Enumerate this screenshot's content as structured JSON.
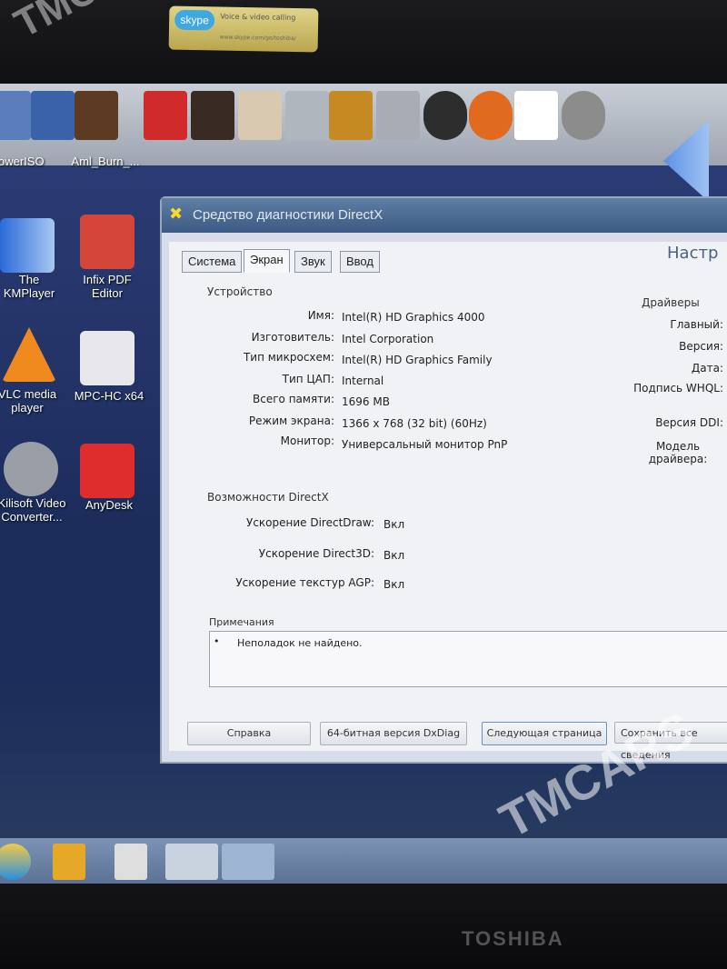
{
  "sticker": {
    "logo": "skype",
    "tagline": "Voice & video calling",
    "url": "www.skype.com/go/toshiba/"
  },
  "watermark": "TMCARS",
  "toolbar": {
    "labels": [
      "owerISO",
      "Aml_Burn_..."
    ],
    "icon_names": [
      "poweriso-icon",
      "burn-app-icon",
      "anydesk-icon",
      "game-icon",
      "game-icon",
      "cs-icon",
      "game-icon",
      "gta-iv-icon",
      "settings-icon",
      "aimp-icon",
      "mpc-hc-icon",
      "video-converter-icon",
      "kmplayer-icon"
    ]
  },
  "desktop_icons": [
    {
      "label": "The KMPlayer",
      "icon": "kmplayer-icon"
    },
    {
      "label": "Infix PDF Editor",
      "icon": "pdf-editor-icon"
    },
    {
      "label": "VLC media player",
      "icon": "vlc-icon"
    },
    {
      "label": "MPC-HC x64",
      "icon": "mpc-hc-icon"
    },
    {
      "label": "Kilisoft Video Converter...",
      "icon": "video-converter-icon"
    },
    {
      "label": "AnyDesk",
      "icon": "anydesk-icon"
    }
  ],
  "dialog": {
    "title": "Средство диагностики DirectX",
    "tabs": [
      "Система",
      "Экран",
      "Звук",
      "Ввод"
    ],
    "active_tab": "Экран",
    "right_heading": "Настр",
    "device_group": "Устройство",
    "device": [
      {
        "label": "Имя:",
        "value": "Intel(R) HD Graphics 4000"
      },
      {
        "label": "Изготовитель:",
        "value": "Intel Corporation"
      },
      {
        "label": "Тип микросхем:",
        "value": "Intel(R) HD Graphics Family"
      },
      {
        "label": "Тип ЦАП:",
        "value": "Internal"
      },
      {
        "label": "Всего памяти:",
        "value": "1696 MB"
      },
      {
        "label": "Режим экрана:",
        "value": "1366 x 768 (32 bit) (60Hz)"
      },
      {
        "label": "Монитор:",
        "value": "Универсальный монитор PnP"
      }
    ],
    "drivers_group": "Драйверы",
    "drivers": [
      "Главный:",
      "Версия:",
      "Дата:",
      "Подпись WHQL:",
      "Версия DDI:",
      "Модель драйвера:"
    ],
    "directx_group": "Возможности DirectX",
    "directx": [
      {
        "label": "Ускорение DirectDraw:",
        "value": "Вкл"
      },
      {
        "label": "Ускорение Direct3D:",
        "value": "Вкл"
      },
      {
        "label": "Ускорение текстур AGP:",
        "value": "Вкл"
      }
    ],
    "notes_group": "Примечания",
    "notes": "Неполадок не найдено.",
    "buttons": [
      "Справка",
      "64-битная версия DxDiag",
      "Следующая страница",
      "Сохранить все сведения"
    ]
  },
  "taskbar": {
    "items": [
      "ie-icon",
      "explorer-icon",
      "media-icon",
      "folder-icon",
      "dxdiag-icon"
    ]
  },
  "brand": "TOSHIBA"
}
